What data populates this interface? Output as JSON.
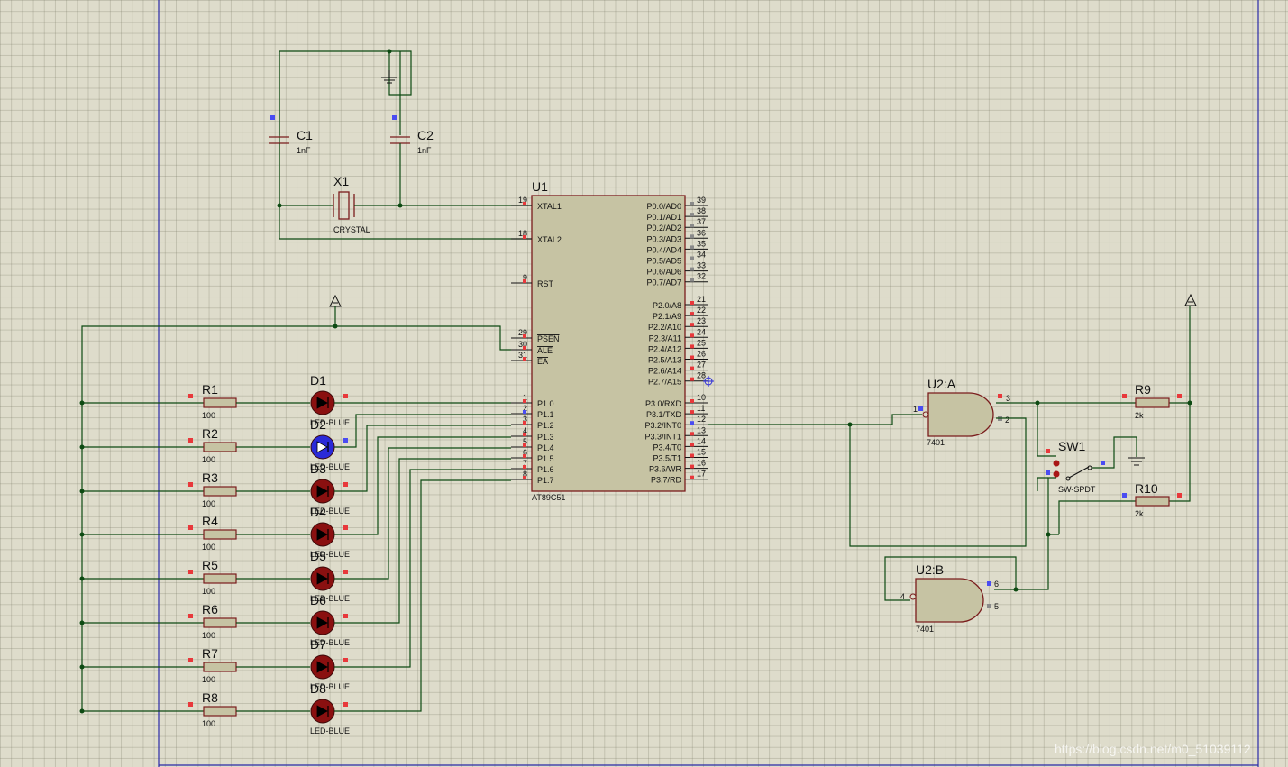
{
  "schematic": {
    "mcu": {
      "ref": "U1",
      "part": "AT89C51",
      "left_pins": [
        {
          "num": "19",
          "name": "XTAL1"
        },
        {
          "num": "18",
          "name": "XTAL2"
        },
        {
          "num": "9",
          "name": "RST"
        },
        {
          "num": "29",
          "name": "PSEN"
        },
        {
          "num": "30",
          "name": "ALE"
        },
        {
          "num": "31",
          "name": "EA"
        },
        {
          "num": "1",
          "name": "P1.0"
        },
        {
          "num": "2",
          "name": "P1.1"
        },
        {
          "num": "3",
          "name": "P1.2"
        },
        {
          "num": "4",
          "name": "P1.3"
        },
        {
          "num": "5",
          "name": "P1.4"
        },
        {
          "num": "6",
          "name": "P1.5"
        },
        {
          "num": "7",
          "name": "P1.6"
        },
        {
          "num": "8",
          "name": "P1.7"
        }
      ],
      "right_pins": [
        {
          "num": "39",
          "name": "P0.0/AD0"
        },
        {
          "num": "38",
          "name": "P0.1/AD1"
        },
        {
          "num": "37",
          "name": "P0.2/AD2"
        },
        {
          "num": "36",
          "name": "P0.3/AD3"
        },
        {
          "num": "35",
          "name": "P0.4/AD4"
        },
        {
          "num": "34",
          "name": "P0.5/AD5"
        },
        {
          "num": "33",
          "name": "P0.6/AD6"
        },
        {
          "num": "32",
          "name": "P0.7/AD7"
        },
        {
          "num": "21",
          "name": "P2.0/A8"
        },
        {
          "num": "22",
          "name": "P2.1/A9"
        },
        {
          "num": "23",
          "name": "P2.2/A10"
        },
        {
          "num": "24",
          "name": "P2.3/A11"
        },
        {
          "num": "25",
          "name": "P2.4/A12"
        },
        {
          "num": "26",
          "name": "P2.5/A13"
        },
        {
          "num": "27",
          "name": "P2.6/A14"
        },
        {
          "num": "28",
          "name": "P2.7/A15"
        },
        {
          "num": "10",
          "name": "P3.0/RXD"
        },
        {
          "num": "11",
          "name": "P3.1/TXD"
        },
        {
          "num": "12",
          "name": "P3.2/INT0"
        },
        {
          "num": "13",
          "name": "P3.3/INT1"
        },
        {
          "num": "14",
          "name": "P3.4/T0"
        },
        {
          "num": "15",
          "name": "P3.5/T1"
        },
        {
          "num": "16",
          "name": "P3.6/WR"
        },
        {
          "num": "17",
          "name": "P3.7/RD"
        }
      ]
    },
    "crystal": {
      "ref": "X1",
      "value": "CRYSTAL"
    },
    "capacitors": [
      {
        "ref": "C1",
        "value": "1nF"
      },
      {
        "ref": "C2",
        "value": "1nF"
      }
    ],
    "led_resistors": [
      {
        "ref": "R1",
        "value": "100"
      },
      {
        "ref": "R2",
        "value": "100"
      },
      {
        "ref": "R3",
        "value": "100"
      },
      {
        "ref": "R4",
        "value": "100"
      },
      {
        "ref": "R5",
        "value": "100"
      },
      {
        "ref": "R6",
        "value": "100"
      },
      {
        "ref": "R7",
        "value": "100"
      },
      {
        "ref": "R8",
        "value": "100"
      }
    ],
    "leds": [
      {
        "ref": "D1",
        "part": "LED-BLUE",
        "lit": false
      },
      {
        "ref": "D2",
        "part": "LED-BLUE",
        "lit": true
      },
      {
        "ref": "D3",
        "part": "LED-BLUE",
        "lit": false
      },
      {
        "ref": "D4",
        "part": "LED-BLUE",
        "lit": false
      },
      {
        "ref": "D5",
        "part": "LED-BLUE",
        "lit": false
      },
      {
        "ref": "D6",
        "part": "LED-BLUE",
        "lit": false
      },
      {
        "ref": "D7",
        "part": "LED-BLUE",
        "lit": false
      },
      {
        "ref": "D8",
        "part": "LED-BLUE",
        "lit": false
      }
    ],
    "gates": [
      {
        "ref": "U2:A",
        "part": "7401",
        "in1": "1",
        "in2": "2",
        "out": "3"
      },
      {
        "ref": "U2:B",
        "part": "7401",
        "in1": "4",
        "in2": "5",
        "out": "6"
      }
    ],
    "switch": {
      "ref": "SW1",
      "part": "SW-SPDT"
    },
    "pullups": [
      {
        "ref": "R9",
        "value": "2k"
      },
      {
        "ref": "R10",
        "value": "2k"
      }
    ],
    "watermark": "https://blog.csdn.net/m0_51039112"
  },
  "colors": {
    "background": "#dedccb",
    "wire": "#0d4a12",
    "component_outline": "#7a1c1c",
    "component_fill": "#c6c3a3",
    "pin_high": "#e8383b",
    "pin_low": "#4a4cf2",
    "led_lit": "#2a2ad8",
    "led_off": "#8a1010"
  }
}
